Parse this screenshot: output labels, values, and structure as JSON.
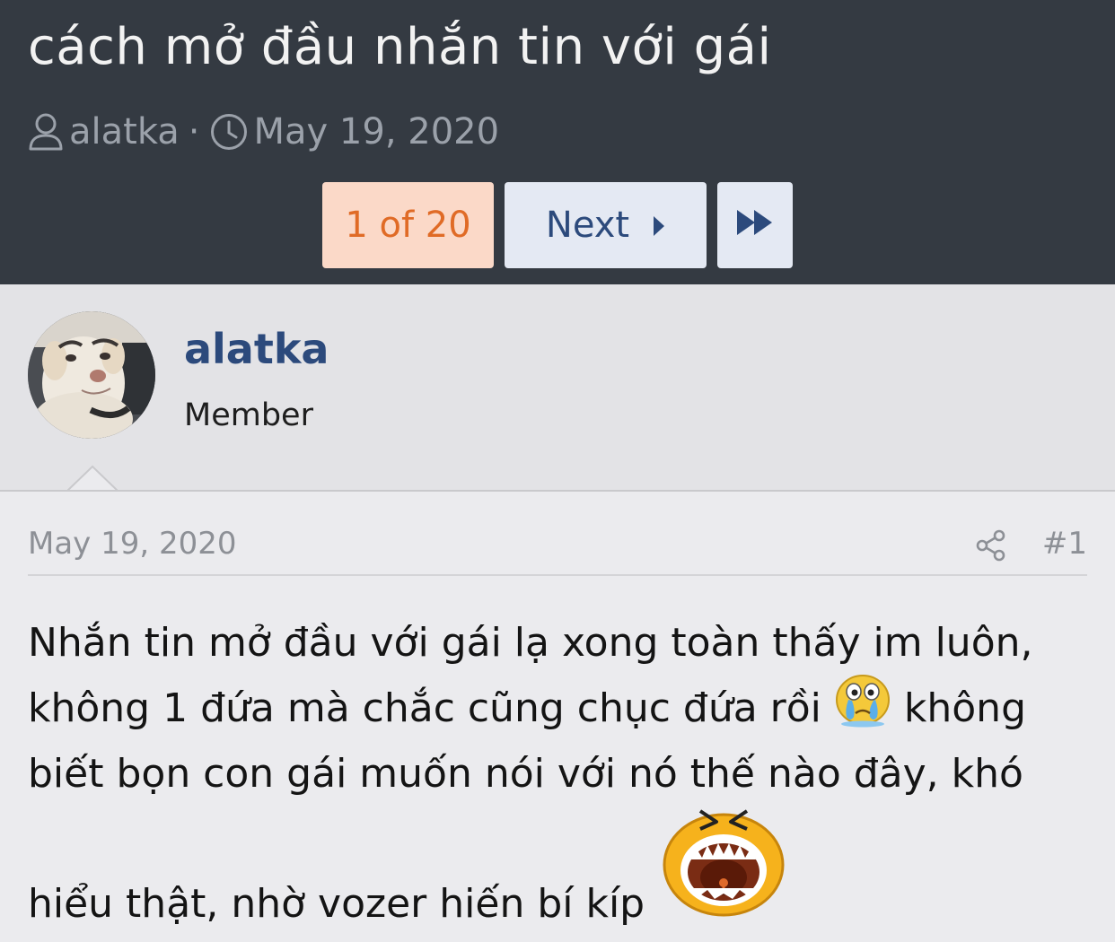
{
  "thread": {
    "title": "cách mở đầu nhắn tin với gái",
    "author": "alatka",
    "separator": "·",
    "date": "May 19, 2020"
  },
  "pagination": {
    "current": "1 of 20",
    "next_label": "Next"
  },
  "user": {
    "name": "alatka",
    "title": "Member"
  },
  "post": {
    "date": "May 19, 2020",
    "number": "#1",
    "lines": [
      "Nhắn tin mở đầu với gái lạ xong toàn thấy im luôn,",
      "không 1 đứa mà chắc cũng chục đứa rồi",
      "không",
      "biết bọn con gái muốn nói với nó thế nào đây, khó",
      "hiểu thật, nhờ vozer hiến bí kíp"
    ]
  },
  "colors": {
    "header_bg": "#343a42",
    "accent_blue": "#2c4a7c",
    "current_page_bg": "#fbd9c8",
    "current_page_text": "#e06b26"
  }
}
